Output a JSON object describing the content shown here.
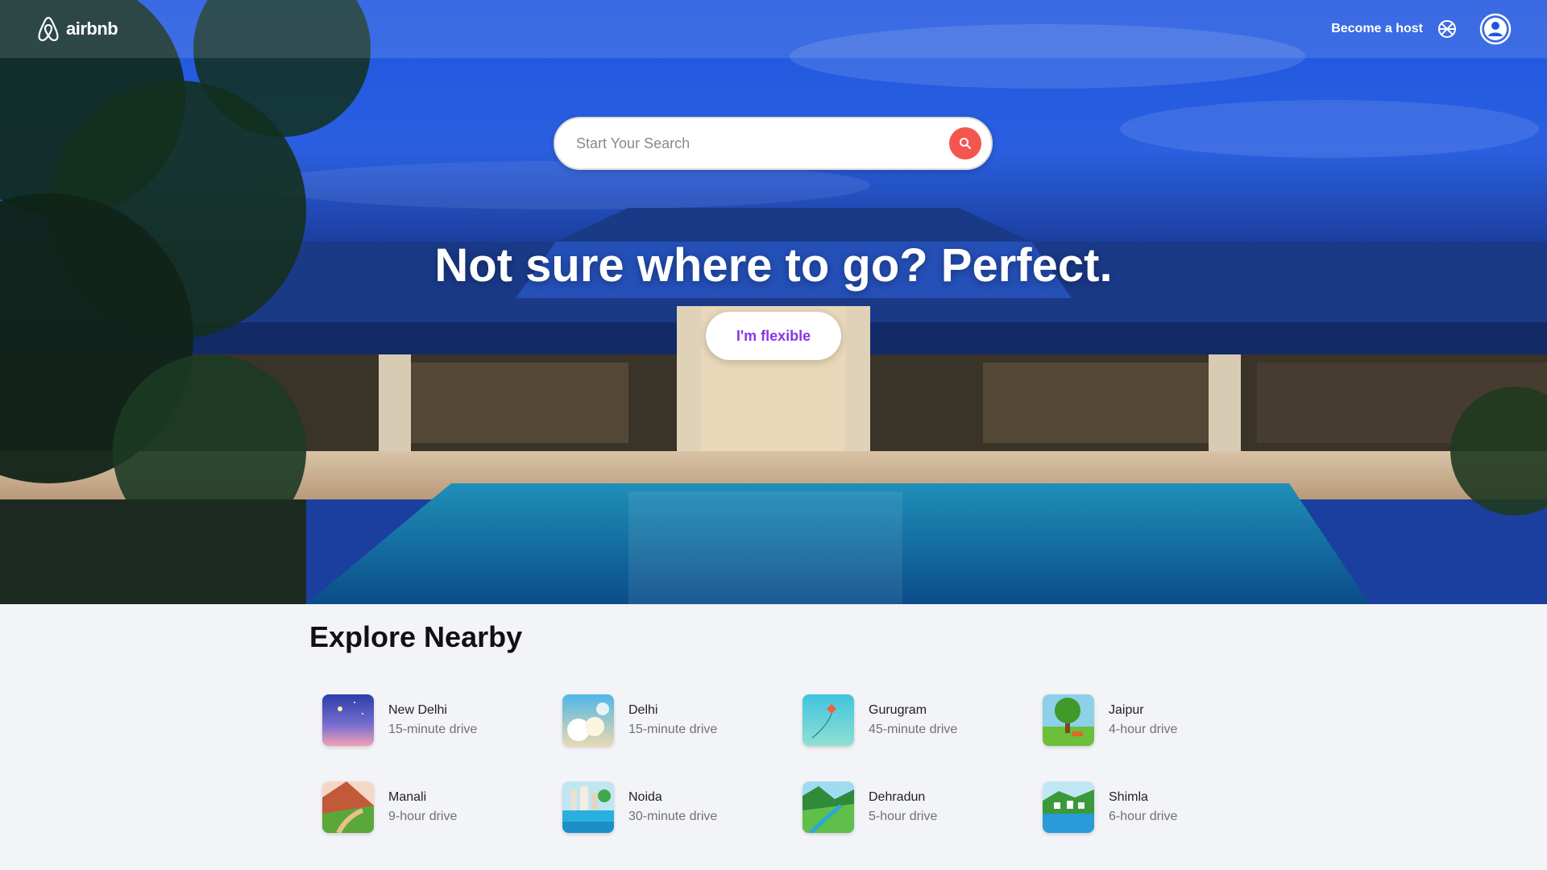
{
  "header": {
    "brand": "airbnb",
    "become_host": "Become a host"
  },
  "search": {
    "placeholder": "Start Your Search"
  },
  "hero": {
    "title": "Not sure where to go? Perfect.",
    "flexible_label": "I'm flexible"
  },
  "colors": {
    "accent_red": "#f2564f",
    "flexible_purple": "#8a34e6",
    "sky_blue": "#1c4fd8"
  },
  "explore": {
    "title": "Explore Nearby",
    "items": [
      {
        "city": "New Delhi",
        "distance": "15-minute drive",
        "thumb": "night-sky"
      },
      {
        "city": "Delhi",
        "distance": "15-minute drive",
        "thumb": "clouds"
      },
      {
        "city": "Gurugram",
        "distance": "45-minute drive",
        "thumb": "kite-sky"
      },
      {
        "city": "Jaipur",
        "distance": "4-hour drive",
        "thumb": "park-tree"
      },
      {
        "city": "Manali",
        "distance": "9-hour drive",
        "thumb": "hills-road"
      },
      {
        "city": "Noida",
        "distance": "30-minute drive",
        "thumb": "city-lake"
      },
      {
        "city": "Dehradun",
        "distance": "5-hour drive",
        "thumb": "green-valley"
      },
      {
        "city": "Shimla",
        "distance": "6-hour drive",
        "thumb": "lake-village"
      }
    ]
  }
}
